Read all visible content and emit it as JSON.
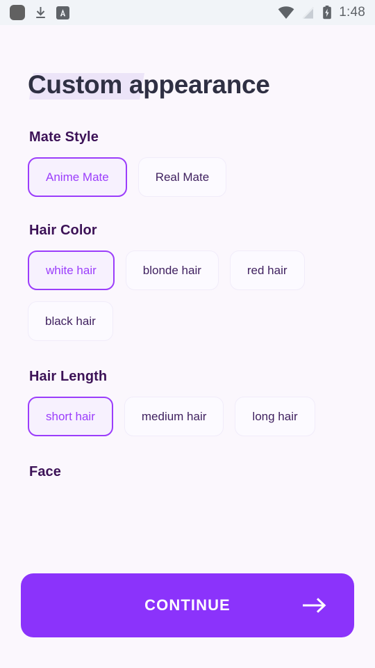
{
  "status_bar": {
    "icons_left": [
      "app-square-icon",
      "download-icon",
      "grammarly-a-icon"
    ],
    "icons_right": [
      "wifi-icon",
      "no-signal-icon",
      "battery-charging-icon"
    ],
    "time": "1:48"
  },
  "header": {
    "title": "Custom appearance",
    "title_highlight_word": "Custom",
    "highlight_color": "#ece4f8"
  },
  "theme": {
    "background": "#fbf7fd",
    "accent": "#8b33fb",
    "chip_selected_border": "#9b3dfb",
    "chip_selected_bg": "#f7f1fe",
    "chip_text": "#3e1f5e",
    "section_title_color": "#3c1257",
    "status_bar_bg": "#f1f4f8"
  },
  "sections": [
    {
      "title": "Mate Style",
      "options": [
        {
          "label": "Anime Mate",
          "selected": true
        },
        {
          "label": "Real Mate",
          "selected": false
        }
      ]
    },
    {
      "title": "Hair Color",
      "options": [
        {
          "label": "white hair",
          "selected": true
        },
        {
          "label": "blonde hair",
          "selected": false
        },
        {
          "label": "red hair",
          "selected": false
        },
        {
          "label": "black hair",
          "selected": false
        }
      ]
    },
    {
      "title": "Hair Length",
      "options": [
        {
          "label": "short hair",
          "selected": true
        },
        {
          "label": "medium hair",
          "selected": false
        },
        {
          "label": "long hair",
          "selected": false
        }
      ]
    },
    {
      "title": "Face",
      "options": []
    }
  ],
  "cta": {
    "label": "CONTINUE",
    "icon": "arrow-right-icon"
  }
}
